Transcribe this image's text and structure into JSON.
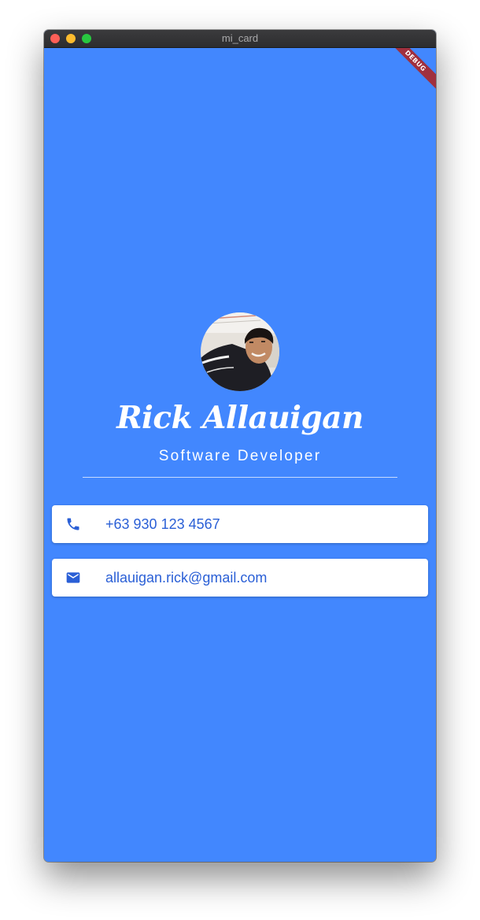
{
  "window": {
    "title": "mi_card",
    "debug_banner": "DEBUG"
  },
  "profile": {
    "name": "Rick Allauigan",
    "role": "Software Developer"
  },
  "contacts": [
    {
      "icon": "phone-icon",
      "value": "+63 930 123 4567"
    },
    {
      "icon": "email-icon",
      "value": "allauigan.rick@gmail.com"
    }
  ],
  "colors": {
    "background": "#4287fe",
    "card": "#ffffff",
    "text_accent": "#2a5fd6",
    "debug_banner": "#a0303e"
  }
}
